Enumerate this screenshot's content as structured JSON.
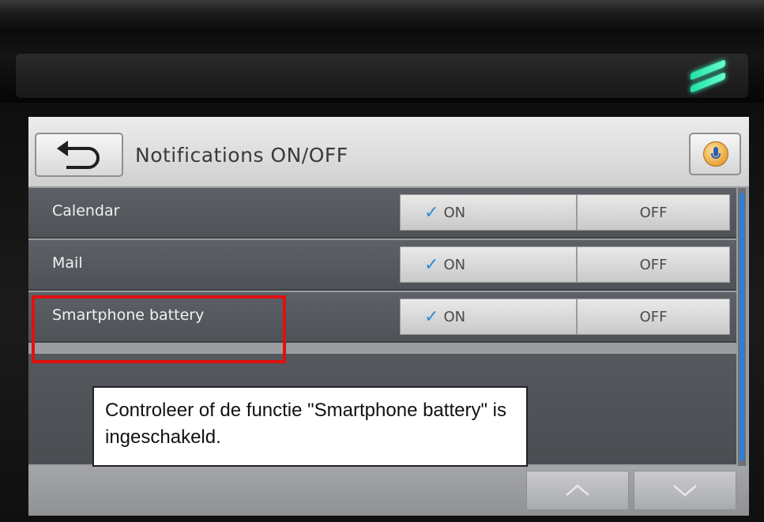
{
  "header": {
    "title": "Notifications ON/OFF",
    "back_icon": "back-arrow-icon",
    "mic_icon": "microphone-icon"
  },
  "settings": [
    {
      "label": "Calendar",
      "on_label": "ON",
      "off_label": "OFF",
      "selected": "ON"
    },
    {
      "label": "Mail",
      "on_label": "ON",
      "off_label": "OFF",
      "selected": "ON"
    },
    {
      "label": "Smartphone battery",
      "on_label": "ON",
      "off_label": "OFF",
      "selected": "ON"
    }
  ],
  "footer": {
    "scroll_up_icon": "chevron-up-icon",
    "scroll_down_icon": "chevron-down-icon"
  },
  "annotation": {
    "callout_text": "Controleer of de functie \"Smartphone battery\" is ingeschakeld.",
    "highlight_color": "#e01010"
  },
  "colors": {
    "checkmark": "#2a8bd6",
    "status_light": "#3dfcc0"
  }
}
